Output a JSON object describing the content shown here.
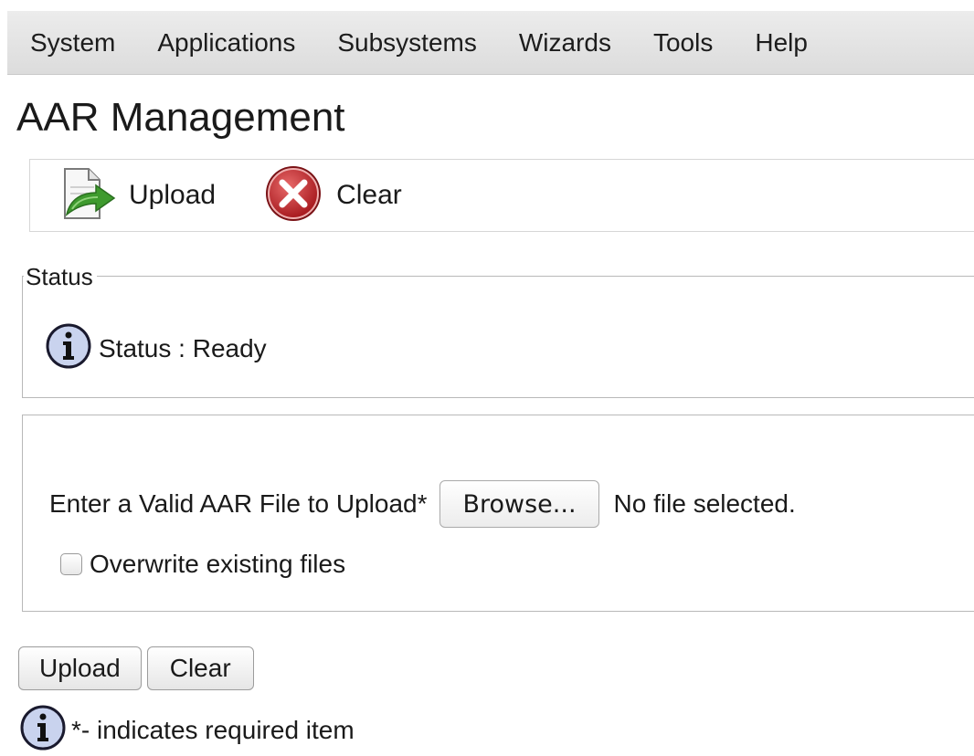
{
  "menu": {
    "items": [
      "System",
      "Applications",
      "Subsystems",
      "Wizards",
      "Tools",
      "Help"
    ]
  },
  "page_title": "AAR Management",
  "toolbar": {
    "upload_label": "Upload",
    "upload_icon": "upload-document-icon",
    "clear_label": "Clear",
    "clear_icon": "red-x-circle-icon"
  },
  "status_section": {
    "legend": "Status",
    "icon": "info-icon",
    "text": "Status : Ready"
  },
  "upload_form": {
    "file_label": "Enter a Valid AAR File to Upload*",
    "browse_label": "Browse...",
    "file_status": "No file selected.",
    "overwrite_label": "Overwrite existing files",
    "overwrite_checked": false
  },
  "buttons": {
    "upload_label": "Upload",
    "clear_label": "Clear"
  },
  "note": {
    "icon": "info-icon",
    "text": "*- indicates required item"
  },
  "colors": {
    "menubar_bg": "#e2e2e2",
    "clear_icon_red": "#c0282d",
    "upload_arrow_green": "#3e9a2e",
    "info_icon_fill": "#c9d3ee"
  }
}
